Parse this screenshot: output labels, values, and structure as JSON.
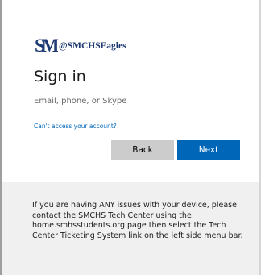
{
  "brand": {
    "monogram": "SM",
    "name": "@SMCHSEagles",
    "color": "#1f3b73"
  },
  "signin": {
    "title": "Sign in",
    "email_placeholder": "Email, phone, or Skype",
    "email_value": "",
    "cant_access_link": "Can't access your account?",
    "back_label": "Back",
    "next_label": "Next"
  },
  "help_text": "If you are having ANY issues with your device, please contact the SMCHS Tech Center using the home.smhsstudents.org page then select the Tech Center Ticketing System link on the left side menu bar.",
  "colors": {
    "accent": "#0067b8",
    "back_button": "#cccccc",
    "footer_bg": "#f0f0f0"
  }
}
